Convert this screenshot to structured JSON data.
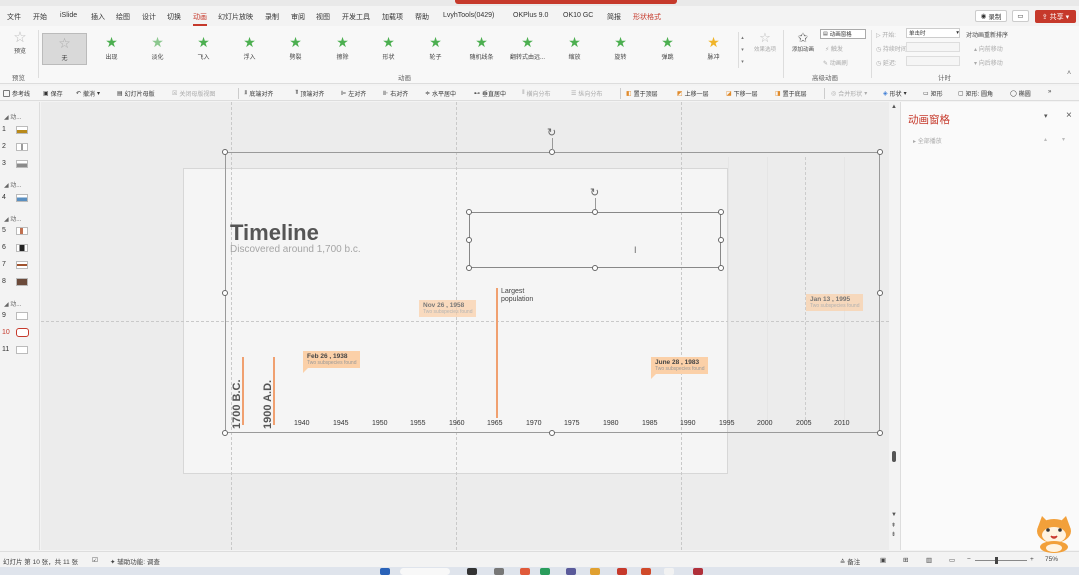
{
  "menubar": {
    "items": [
      {
        "label": "文件"
      },
      {
        "label": "开始"
      },
      {
        "label": "iSlide"
      },
      {
        "label": "插入"
      },
      {
        "label": "绘图"
      },
      {
        "label": "设计"
      },
      {
        "label": "切换"
      },
      {
        "label": "动画"
      },
      {
        "label": "幻灯片放映"
      },
      {
        "label": "录制"
      },
      {
        "label": "审阅"
      },
      {
        "label": "视图"
      },
      {
        "label": "开发工具"
      },
      {
        "label": "加载项"
      },
      {
        "label": "帮助"
      },
      {
        "label": "LvyhTools(0429)"
      },
      {
        "label": "OKPlus 9.0"
      },
      {
        "label": "OK10 GC"
      },
      {
        "label": "简报"
      },
      {
        "label": "形状格式"
      }
    ],
    "record_label": "录制",
    "share_label": "共享"
  },
  "ribbon": {
    "preview_label": "预览",
    "preview_group_label": "预览",
    "effects": [
      {
        "label": "无"
      },
      {
        "label": "出现"
      },
      {
        "label": "淡化"
      },
      {
        "label": "飞入"
      },
      {
        "label": "浮入"
      },
      {
        "label": "劈裂"
      },
      {
        "label": "擦除"
      },
      {
        "label": "形状"
      },
      {
        "label": "轮子"
      },
      {
        "label": "随机线条"
      },
      {
        "label": "翻转式由远..."
      },
      {
        "label": "缩放"
      },
      {
        "label": "旋转"
      },
      {
        "label": "弹跳"
      },
      {
        "label": "脉冲"
      }
    ],
    "animation_group_label": "动画",
    "effect_options_label": "效果选项",
    "add_animation_label": "添加动画",
    "animation_pane_label": "动画窗格",
    "trigger_label": "触发",
    "animation_painter_label": "动画刷",
    "advanced_group_label": "高级动画",
    "start_label": "开始:",
    "start_value": "单击时",
    "duration_label": "持续时间:",
    "delay_label": "延迟:",
    "timing_group_label": "计时",
    "reorder_label": "对动画重新排序",
    "move_earlier_label": "向前移动",
    "move_later_label": "向后移动"
  },
  "toolbar2": {
    "items": [
      {
        "label": "参考线"
      },
      {
        "label": "保存"
      },
      {
        "label": "撤消"
      },
      {
        "label": "幻灯片母版"
      },
      {
        "label": "关闭母版视图"
      },
      {
        "label": "底端对齐"
      },
      {
        "label": "顶端对齐"
      },
      {
        "label": "左对齐"
      },
      {
        "label": "右对齐"
      },
      {
        "label": "水平居中"
      },
      {
        "label": "垂直居中"
      },
      {
        "label": "横向分布"
      },
      {
        "label": "纵向分布"
      },
      {
        "label": "置于顶层"
      },
      {
        "label": "上移一层"
      },
      {
        "label": "下移一层"
      },
      {
        "label": "置于底层"
      },
      {
        "label": "合并形状"
      },
      {
        "label": "形状"
      },
      {
        "label": "矩形"
      },
      {
        "label": "矩形: 圆角"
      },
      {
        "label": "椭圆"
      }
    ]
  },
  "thumbnails": {
    "section_label": "动...",
    "slides": [
      {
        "num": "1"
      },
      {
        "num": "2"
      },
      {
        "num": "3"
      },
      {
        "num": "4"
      },
      {
        "num": "5"
      },
      {
        "num": "6"
      },
      {
        "num": "7"
      },
      {
        "num": "8"
      },
      {
        "num": "9"
      },
      {
        "num": "10"
      },
      {
        "num": "11"
      }
    ]
  },
  "slide": {
    "title": "Timeline",
    "subtitle": "Discovered around 1,700 b.c.",
    "vlabel_1": "1700 B.C.",
    "vlabel_2": "1900 A.D.",
    "years": [
      "1940",
      "1945",
      "1950",
      "1955",
      "1960",
      "1965",
      "1970",
      "1975",
      "1980",
      "1985",
      "1990",
      "1995",
      "2000",
      "2005",
      "2010"
    ],
    "cards": [
      {
        "date": "Feb 26 , 1938",
        "sub": "Two subspecies found"
      },
      {
        "date": "Nov 26 , 1958",
        "sub": "Two subspecies found"
      },
      {
        "date": "June 28 , 1983",
        "sub": "Two subspecies found"
      },
      {
        "date": "Jan 13 , 1995",
        "sub": "Two subspecies found"
      }
    ],
    "largest_line1": "Largest",
    "largest_line2": "population",
    "accent_color": "#fbd0a8",
    "line_color": "#f0a070"
  },
  "pane": {
    "title": "动画窗格",
    "play_all_label": "全部播放"
  },
  "statusbar": {
    "slide_info": "幻灯片 第 10 张，共 11 张",
    "accessibility": "辅助功能: 调查",
    "notes_label": "备注",
    "zoom": "75%"
  },
  "colors": {
    "brand": "#c6392b",
    "star": "#4caf50"
  }
}
